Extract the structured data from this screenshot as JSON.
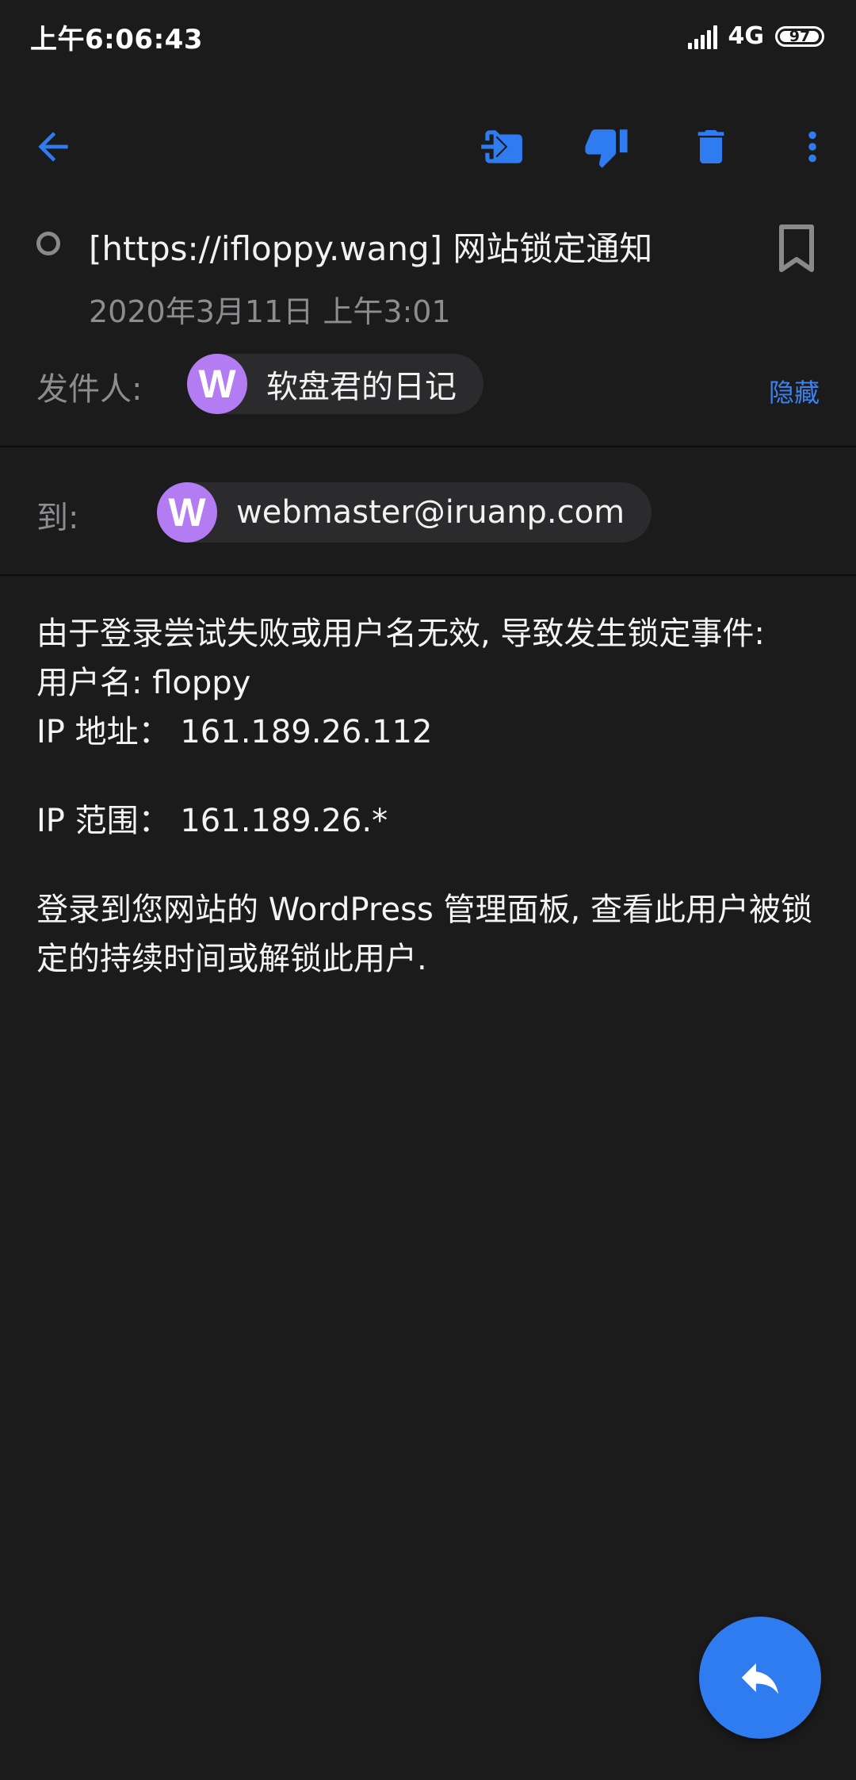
{
  "status_bar": {
    "time": "上午6:06:43",
    "network": "4G",
    "battery": "97",
    "battery_level": 0.97
  },
  "toolbar": {
    "icons": [
      "back-arrow-icon",
      "move-to-folder-icon",
      "thumbs-down-icon",
      "delete-icon",
      "more-vert-icon"
    ],
    "accent_color": "#2f7bf0"
  },
  "email": {
    "subject": "[https://ifloppy.wang] 网站锁定通知",
    "date": "2020年3月11日 上午3:01",
    "from_label": "发件人:",
    "sender_initial": "W",
    "sender_name": "软盘君的日记",
    "hide_label": "隐藏",
    "to_label": "到:",
    "recipient_initial": "W",
    "recipient_email": "webmaster@iruanp.com",
    "avatar_color": "#b47cf2",
    "body": {
      "line1": "由于登录尝试失败或用户名无效, 导致发生锁定事件:",
      "line2": "用户名: floppy",
      "line3": "IP 地址： 161.189.26.112",
      "line4": "IP 范围： 161.189.26.*",
      "line5": "登录到您网站的 WordPress 管理面板, 查看此用户被锁定的持续时间或解锁此用户."
    }
  },
  "fab": {
    "icon": "reply-icon"
  }
}
